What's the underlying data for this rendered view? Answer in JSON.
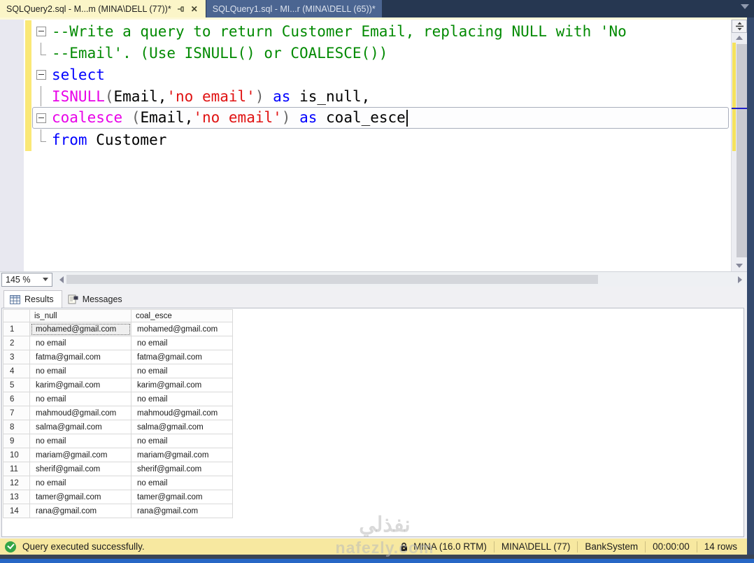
{
  "tabs": {
    "tab1": "SQLQuery2.sql - M...m (MINA\\DELL (77))*",
    "tab2": "SQLQuery1.sql - MI...r (MINA\\DELL (65))*"
  },
  "editor": {
    "colors": {
      "comment": "#028a02",
      "keyword": "#0000ff",
      "function": "#e800e8",
      "string": "#e01212",
      "ident": "#000000",
      "punct": "#666666"
    },
    "lines": [
      {
        "fold": "box",
        "tokens": [
          {
            "c": "comment",
            "t": "--Write a query to return Customer Email, replacing NULL with 'No"
          }
        ]
      },
      {
        "fold": "bar-end",
        "tokens": [
          {
            "c": "comment",
            "t": "--Email'. (Use ISNULL() or COALESCE())"
          }
        ]
      },
      {
        "fold": "box",
        "tokens": [
          {
            "c": "keyword",
            "t": "select"
          }
        ]
      },
      {
        "fold": "bar",
        "tokens": [
          {
            "c": "function",
            "t": "ISNULL"
          },
          {
            "c": "punct",
            "t": "("
          },
          {
            "c": "ident",
            "t": "Email"
          },
          {
            "c": "ident",
            "t": ","
          },
          {
            "c": "string",
            "t": "'no email'"
          },
          {
            "c": "punct",
            "t": ")"
          },
          {
            "c": "ident",
            "t": " "
          },
          {
            "c": "keyword",
            "t": "as"
          },
          {
            "c": "ident",
            "t": " is_null,"
          }
        ]
      },
      {
        "fold": "box",
        "current": true,
        "cursor": true,
        "tokens": [
          {
            "c": "function",
            "t": "coalesce"
          },
          {
            "c": "ident",
            "t": " "
          },
          {
            "c": "punct",
            "t": "("
          },
          {
            "c": "ident",
            "t": "Email"
          },
          {
            "c": "ident",
            "t": ","
          },
          {
            "c": "string",
            "t": "'no email'"
          },
          {
            "c": "punct",
            "t": ")"
          },
          {
            "c": "ident",
            "t": " "
          },
          {
            "c": "keyword",
            "t": "as"
          },
          {
            "c": "ident",
            "t": " coal_esce"
          }
        ]
      },
      {
        "fold": "bar-end",
        "tokens": [
          {
            "c": "keyword",
            "t": "from"
          },
          {
            "c": "ident",
            "t": " Customer"
          }
        ]
      }
    ]
  },
  "zoom_control": {
    "value": "145 %"
  },
  "results_tabs": {
    "results": "Results",
    "messages": "Messages"
  },
  "grid": {
    "columns": [
      "is_null",
      "coal_esce"
    ],
    "rows": [
      [
        "mohamed@gmail.com",
        "mohamed@gmail.com"
      ],
      [
        "no email",
        "no email"
      ],
      [
        "fatma@gmail.com",
        "fatma@gmail.com"
      ],
      [
        "no email",
        "no email"
      ],
      [
        "karim@gmail.com",
        "karim@gmail.com"
      ],
      [
        "no email",
        "no email"
      ],
      [
        "mahmoud@gmail.com",
        "mahmoud@gmail.com"
      ],
      [
        "salma@gmail.com",
        "salma@gmail.com"
      ],
      [
        "no email",
        "no email"
      ],
      [
        "mariam@gmail.com",
        "mariam@gmail.com"
      ],
      [
        "sherif@gmail.com",
        "sherif@gmail.com"
      ],
      [
        "no email",
        "no email"
      ],
      [
        "tamer@gmail.com",
        "tamer@gmail.com"
      ],
      [
        "rana@gmail.com",
        "rana@gmail.com"
      ]
    ],
    "selected": {
      "row": 0,
      "col": 0
    }
  },
  "status_bar": {
    "message": "Query executed successfully.",
    "server": "MINA (16.0 RTM)",
    "user": "MINA\\DELL (77)",
    "database": "BankSystem",
    "time": "00:00:00",
    "rows": "14 rows"
  },
  "watermark": {
    "line1": "نفذلي",
    "line2": "nafezly.com"
  }
}
